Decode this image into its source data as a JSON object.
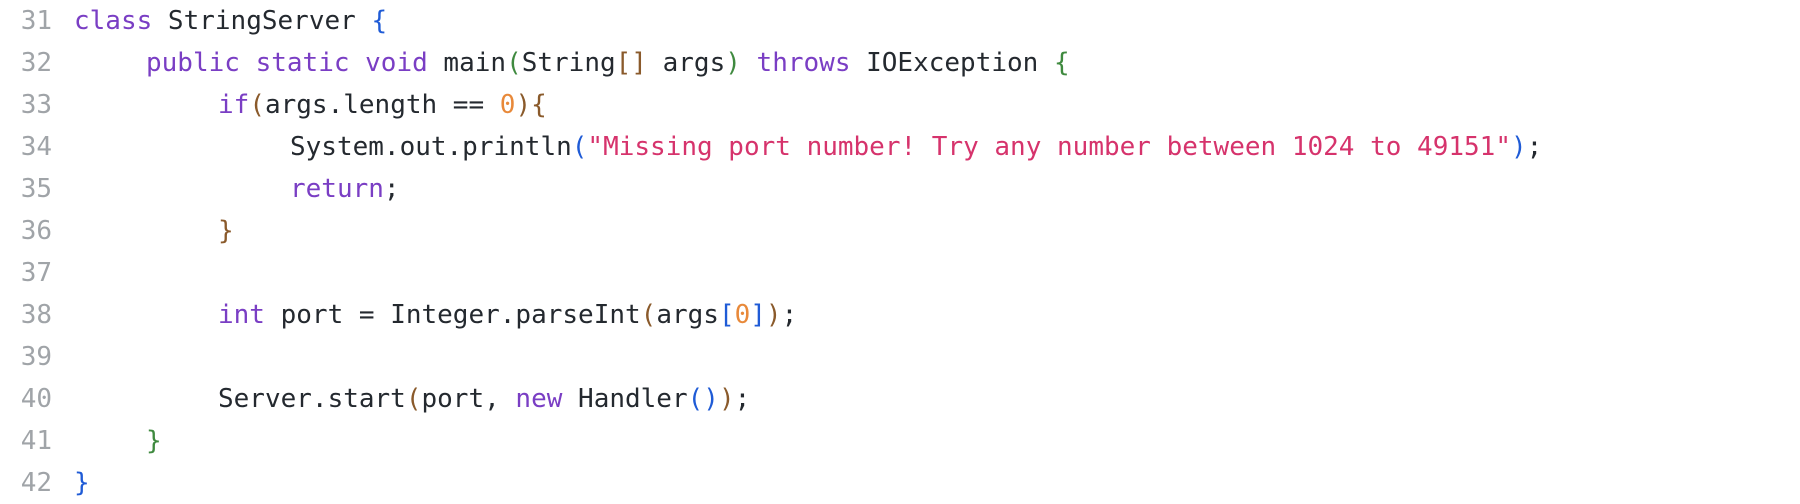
{
  "colors": {
    "background": "#ffffff",
    "line_number": "#a0a4a8",
    "plain": "#24292f",
    "keyword": "#7a3ec4",
    "string": "#d6336c",
    "number": "#e8893a",
    "bracket_blue": "#1f5bd6",
    "bracket_green": "#3f8a3f",
    "bracket_brown": "#8a5a2b"
  },
  "lines": [
    {
      "number": "31",
      "indent": 0,
      "tokens": [
        {
          "t": "class",
          "c": "keyword"
        },
        {
          "t": " StringServer ",
          "c": "plain"
        },
        {
          "t": "{",
          "c": "bracket_blue"
        }
      ]
    },
    {
      "number": "32",
      "indent": 1,
      "tokens": [
        {
          "t": "public",
          "c": "keyword"
        },
        {
          "t": " ",
          "c": "plain"
        },
        {
          "t": "static",
          "c": "keyword"
        },
        {
          "t": " ",
          "c": "plain"
        },
        {
          "t": "void",
          "c": "keyword"
        },
        {
          "t": " main",
          "c": "plain"
        },
        {
          "t": "(",
          "c": "bracket_green"
        },
        {
          "t": "String",
          "c": "plain"
        },
        {
          "t": "[]",
          "c": "bracket_brown"
        },
        {
          "t": " args",
          "c": "plain"
        },
        {
          "t": ")",
          "c": "bracket_green"
        },
        {
          "t": " ",
          "c": "plain"
        },
        {
          "t": "throws",
          "c": "keyword"
        },
        {
          "t": " IOException ",
          "c": "plain"
        },
        {
          "t": "{",
          "c": "bracket_green"
        }
      ]
    },
    {
      "number": "33",
      "indent": 2,
      "tokens": [
        {
          "t": "if",
          "c": "keyword"
        },
        {
          "t": "(",
          "c": "bracket_brown"
        },
        {
          "t": "args.length == ",
          "c": "plain"
        },
        {
          "t": "0",
          "c": "number"
        },
        {
          "t": "){",
          "c": "bracket_brown"
        }
      ]
    },
    {
      "number": "34",
      "indent": 3,
      "tokens": [
        {
          "t": "System.out.println",
          "c": "plain"
        },
        {
          "t": "(",
          "c": "bracket_blue"
        },
        {
          "t": "\"Missing port number! Try any number between 1024 to 49151\"",
          "c": "string"
        },
        {
          "t": ")",
          "c": "bracket_blue"
        },
        {
          "t": ";",
          "c": "plain"
        }
      ]
    },
    {
      "number": "35",
      "indent": 3,
      "tokens": [
        {
          "t": "return",
          "c": "keyword"
        },
        {
          "t": ";",
          "c": "plain"
        }
      ]
    },
    {
      "number": "36",
      "indent": 2,
      "tokens": [
        {
          "t": "}",
          "c": "bracket_brown"
        }
      ]
    },
    {
      "number": "37",
      "indent": 0,
      "tokens": []
    },
    {
      "number": "38",
      "indent": 2,
      "tokens": [
        {
          "t": "int",
          "c": "keyword"
        },
        {
          "t": " port = Integer.parseInt",
          "c": "plain"
        },
        {
          "t": "(",
          "c": "bracket_brown"
        },
        {
          "t": "args",
          "c": "plain"
        },
        {
          "t": "[",
          "c": "bracket_blue"
        },
        {
          "t": "0",
          "c": "number"
        },
        {
          "t": "]",
          "c": "bracket_blue"
        },
        {
          "t": ")",
          "c": "bracket_brown"
        },
        {
          "t": ";",
          "c": "plain"
        }
      ]
    },
    {
      "number": "39",
      "indent": 0,
      "tokens": []
    },
    {
      "number": "40",
      "indent": 2,
      "tokens": [
        {
          "t": "Server.start",
          "c": "plain"
        },
        {
          "t": "(",
          "c": "bracket_brown"
        },
        {
          "t": "port, ",
          "c": "plain"
        },
        {
          "t": "new",
          "c": "keyword"
        },
        {
          "t": " Handler",
          "c": "plain"
        },
        {
          "t": "()",
          "c": "bracket_blue"
        },
        {
          "t": ")",
          "c": "bracket_brown"
        },
        {
          "t": ";",
          "c": "plain"
        }
      ]
    },
    {
      "number": "41",
      "indent": 1,
      "tokens": [
        {
          "t": "}",
          "c": "bracket_green"
        }
      ]
    },
    {
      "number": "42",
      "indent": 0,
      "tokens": [
        {
          "t": "}",
          "c": "bracket_blue"
        }
      ]
    }
  ]
}
